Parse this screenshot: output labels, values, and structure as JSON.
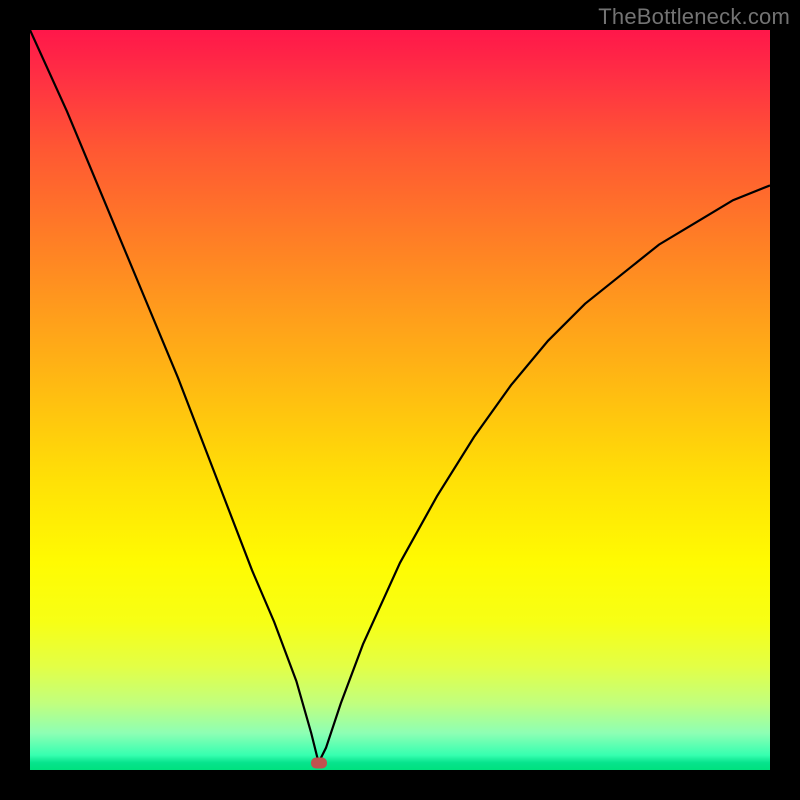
{
  "watermark": "TheBottleneck.com",
  "colors": {
    "frame": "#000000",
    "curve": "#000000",
    "marker": "#c0524f"
  },
  "chart_data": {
    "type": "line",
    "title": "",
    "xlabel": "",
    "ylabel": "",
    "xlim": [
      0,
      100
    ],
    "ylim": [
      0,
      100
    ],
    "grid": false,
    "legend": false,
    "annotations": [],
    "marker": {
      "x": 39,
      "y": 1
    },
    "series": [
      {
        "name": "bottleneck-curve",
        "x": [
          0,
          5,
          10,
          15,
          20,
          25,
          30,
          33,
          36,
          38,
          39,
          40,
          42,
          45,
          50,
          55,
          60,
          65,
          70,
          75,
          80,
          85,
          90,
          95,
          100
        ],
        "y": [
          100,
          89,
          77,
          65,
          53,
          40,
          27,
          20,
          12,
          5,
          1,
          3,
          9,
          17,
          28,
          37,
          45,
          52,
          58,
          63,
          67,
          71,
          74,
          77,
          79
        ]
      }
    ]
  }
}
